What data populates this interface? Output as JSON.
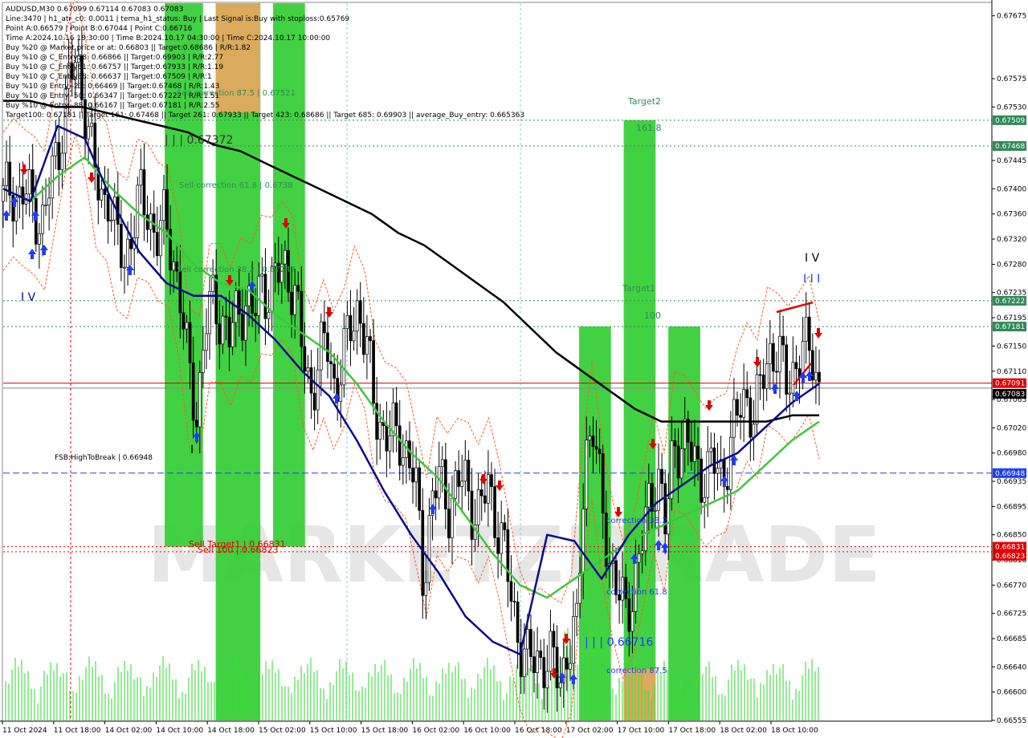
{
  "header": {
    "lines": [
      "AUDUSD,M30  0.67099 0.67114 0.67083 0.67083",
      "Line:3470 | h1_atr_c0: 0.0011 | tema_h1_status: Buy | Last Signal is:Buy with stoploss:0.65769",
      "Point A:0.66579 | Point B:0.67044 | Point C:0.66716",
      "Time A:2024.10.16 18:30:00 | Time B:2024.10.17 04:30:00 | Time C:2024.10.17 10:00:00",
      "Buy %20 @ Market price or at: 0.66803 || Target:0.68686 | R/R:1.82",
      "Buy %10 @ C_Entry38: 0.66866 || Target:0.69903 | R/R:2.77",
      "Buy %10 @ C_Entry61: 0.66757 || Target:0.67933 | R/R:1.19",
      "Buy %10 @ C_Entry88: 0.66637 || Target:0.67509 | R/R:1",
      "Buy %10 @ Entry -23: 0.66469 || Target:0.67468 | R/R:1.43",
      "Buy %10 @ Entry -50: 0.66347 || Target:0.67222 | R/R:1.51",
      "Buy %10 @ Entry -88: 0.66167 || Target:0.67181 | R/R:2.55",
      "Target100: 0.67181 || Target 161: 0.67468 || Target 261: 0.67933 || Target 423: 0.68686 || Target 685: 0.69903 || average_Buy_entry: 0.665363"
    ]
  },
  "annotations": {
    "sell_correction_875": "Sell correction 87.5 | 0.67521",
    "level_67372": "| | | 0.67372",
    "sell_correction_618": "Sell correction 61.8 | 0.6738",
    "sell_correction_382": "Sell correction 38.2 | 0.67247",
    "target2": "Target2",
    "fib_1618": "161.8",
    "target1": "Target1",
    "fib_100": "100",
    "wave_iv_left": "I V",
    "wave_iv_right": "I V",
    "wave_iii_right": "I I I",
    "fsb": "FSB:HighToBreak | 0.66948",
    "sell_target1": "Sell Target1 | 0.66831",
    "sell_100": "Sell 100 | 0.66823",
    "correction_382": "correction 38.2",
    "correction_618": "correction 61.8",
    "correction_875": "correction 87.5",
    "level_66716": "| | | 0.66716",
    "wave_small": "I",
    "watermark": "MARKETZITRADE"
  },
  "price_tags": [
    {
      "value": "0.67509",
      "bg": "#2e8b57"
    },
    {
      "value": "0.67468",
      "bg": "#2e8b57"
    },
    {
      "value": "0.67222",
      "bg": "#2e8b57"
    },
    {
      "value": "0.67181",
      "bg": "#2e8b57"
    },
    {
      "value": "0.67091",
      "bg": "#e00000"
    },
    {
      "value": "0.67083",
      "bg": "#000000"
    },
    {
      "value": "0.66948",
      "bg": "#1e3cff"
    },
    {
      "value": "0.66831",
      "bg": "#e00000"
    },
    {
      "value": "0.66823",
      "bg": "#e00000"
    }
  ],
  "colors": {
    "bull_zone": "#32cd32",
    "bear_zone": "#f4a460",
    "ema_black": "#000000",
    "ema_green": "#3cc83c",
    "ema_navy": "#0a0a8a",
    "envelope": "#ff5a1e",
    "target_line": "#2e8b57",
    "fsb_line": "#1e3cff",
    "price_line": "#e00000"
  },
  "chart_data": {
    "type": "candlestick",
    "symbol": "AUDUSD",
    "timeframe": "M30",
    "ylim": [
      0.66555,
      0.67695
    ],
    "y_ticks": [
      "0.67675",
      "0.67575",
      "0.67530",
      "0.67445",
      "0.67400",
      "0.67360",
      "0.67320",
      "0.67280",
      "0.67235",
      "0.67195",
      "0.67150",
      "0.67110",
      "0.67065",
      "0.67020",
      "0.66980",
      "0.66935",
      "0.66895",
      "0.66850",
      "0.66810",
      "0.66770",
      "0.66725",
      "0.66685",
      "0.66640",
      "0.66600",
      "0.66555"
    ],
    "x_ticks": [
      "11 Oct 2024",
      "11 Oct 18:00",
      "14 Oct 02:00",
      "14 Oct 10:00",
      "14 Oct 18:00",
      "15 Oct 02:00",
      "15 Oct 10:00",
      "15 Oct 18:00",
      "16 Oct 02:00",
      "16 Oct 10:00",
      "16 Oct 18:00",
      "17 Oct 02:00",
      "17 Oct 10:00",
      "17 Oct 18:00",
      "18 Oct 02:00",
      "18 Oct 10:00"
    ],
    "horizontal_levels": [
      {
        "value": 0.67509,
        "style": "dotted"
      },
      {
        "value": 0.67468,
        "style": "dotted"
      },
      {
        "value": 0.67222,
        "style": "dotted"
      },
      {
        "value": 0.67181,
        "style": "dotted"
      },
      {
        "value": 0.67091,
        "style": "solid"
      },
      {
        "value": 0.66948,
        "style": "dashed"
      },
      {
        "value": 0.66831,
        "style": "dotted"
      },
      {
        "value": 0.66823,
        "style": "dotted"
      }
    ],
    "close_series_x": [
      0,
      10,
      20,
      30,
      40,
      50,
      60,
      70,
      80,
      90,
      100,
      110,
      120,
      130,
      140,
      150,
      160,
      170,
      180,
      190,
      200,
      210,
      220,
      230,
      240,
      250,
      260,
      270,
      280,
      290,
      300,
      310,
      320,
      330,
      340,
      350,
      360,
      370,
      380,
      390,
      400,
      410,
      420,
      430,
      440,
      450,
      460,
      470,
      480,
      490,
      500,
      510,
      520,
      530,
      540,
      550,
      560,
      570,
      580,
      590,
      600,
      610,
      620,
      630,
      640,
      650,
      660,
      670,
      680,
      690,
      700,
      710,
      720,
      730,
      740,
      750,
      760,
      770,
      780,
      790,
      800,
      810,
      820,
      830,
      840,
      850,
      860,
      870,
      880,
      890,
      900,
      910,
      920,
      930,
      940,
      950,
      960,
      970,
      980,
      990,
      1000,
      1010
    ],
    "close_series_y": [
      0.6738,
      0.6741,
      0.6738,
      0.6739,
      0.6737,
      0.6734,
      0.6742,
      0.6748,
      0.6756,
      0.676,
      0.6755,
      0.6745,
      0.6738,
      0.674,
      0.6732,
      0.6728,
      0.6735,
      0.6738,
      0.6736,
      0.6733,
      0.6734,
      0.673,
      0.6722,
      0.671,
      0.6705,
      0.6718,
      0.6722,
      0.672,
      0.6716,
      0.672,
      0.6723,
      0.6719,
      0.6725,
      0.6724,
      0.6726,
      0.6728,
      0.6724,
      0.6714,
      0.6708,
      0.6712,
      0.6716,
      0.6709,
      0.6712,
      0.6718,
      0.6722,
      0.6714,
      0.6705,
      0.6702,
      0.67,
      0.6701,
      0.6698,
      0.6693,
      0.6678,
      0.669,
      0.6694,
      0.669,
      0.6692,
      0.6694,
      0.669,
      0.6688,
      0.6693,
      0.6688,
      0.6682,
      0.6674,
      0.6668,
      0.6664,
      0.6666,
      0.6665,
      0.6664,
      0.6663,
      0.6667,
      0.6669,
      0.6699,
      0.6702,
      0.669,
      0.6682,
      0.6676,
      0.6672,
      0.6677,
      0.6683,
      0.669,
      0.6696,
      0.6685,
      0.67,
      0.67,
      0.6698,
      0.6696,
      0.6694,
      0.6696,
      0.6695,
      0.6698,
      0.6705,
      0.6708,
      0.6702,
      0.6711,
      0.6715,
      0.6712,
      0.671,
      0.6712,
      0.6713,
      0.6716,
      0.6708
    ],
    "ema_black_y": [
      0.6754,
      0.6754,
      0.6753,
      0.6753,
      0.6752,
      0.6751,
      0.675,
      0.6749,
      0.6747,
      0.6746,
      0.6744,
      0.6742,
      0.674,
      0.6738,
      0.6736,
      0.6733,
      0.6731,
      0.6728,
      0.6725,
      0.6722,
      0.6718,
      0.6714,
      0.6711,
      0.6708,
      0.6705,
      0.6703,
      0.6703,
      0.6703,
      0.6703,
      0.6703,
      0.6704,
      0.6704
    ],
    "ema_green_y": [
      0.674,
      0.6738,
      0.6742,
      0.6745,
      0.674,
      0.6736,
      0.6733,
      0.6728,
      0.6725,
      0.6724,
      0.672,
      0.6717,
      0.6714,
      0.6709,
      0.6703,
      0.6698,
      0.6694,
      0.6688,
      0.6682,
      0.6677,
      0.6675,
      0.6678,
      0.6681,
      0.6684,
      0.6686,
      0.6688,
      0.669,
      0.6692,
      0.6696,
      0.67,
      0.6703
    ],
    "ema_navy_y": [
      0.674,
      0.6738,
      0.675,
      0.6748,
      0.6738,
      0.673,
      0.6725,
      0.6723,
      0.6723,
      0.672,
      0.6716,
      0.6711,
      0.6707,
      0.67,
      0.6692,
      0.6685,
      0.6679,
      0.6672,
      0.6668,
      0.6666,
      0.6685,
      0.6684,
      0.6678,
      0.6685,
      0.669,
      0.6693,
      0.6696,
      0.6698,
      0.6702,
      0.6706,
      0.6709
    ],
    "zones": [
      {
        "kind": "bull",
        "from": "14 Oct 08:00",
        "to": "14 Oct 14:00",
        "low": 0.66831,
        "high": 0.67695
      },
      {
        "kind": "bull",
        "from": "14 Oct 16:00",
        "to": "14 Oct 23:00",
        "low": 0.66555,
        "high": 0.67695
      },
      {
        "kind": "bear",
        "from": "14 Oct 16:00",
        "to": "14 Oct 23:00",
        "low": 0.67521,
        "high": 0.67695
      },
      {
        "kind": "bull",
        "from": "15 Oct 01:00",
        "to": "15 Oct 06:00",
        "low": 0.66831,
        "high": 0.67695
      },
      {
        "kind": "bull",
        "from": "17 Oct 01:00",
        "to": "17 Oct 06:00",
        "low": 0.66555,
        "high": 0.67181
      },
      {
        "kind": "bull",
        "from": "17 Oct 08:00",
        "to": "17 Oct 13:00",
        "low": 0.66555,
        "high": 0.67509
      },
      {
        "kind": "bear",
        "from": "17 Oct 08:00",
        "to": "17 Oct 13:00",
        "low": 0.66555,
        "high": 0.66637
      },
      {
        "kind": "bull",
        "from": "17 Oct 15:00",
        "to": "17 Oct 20:00",
        "low": 0.66555,
        "high": 0.67181
      }
    ]
  }
}
